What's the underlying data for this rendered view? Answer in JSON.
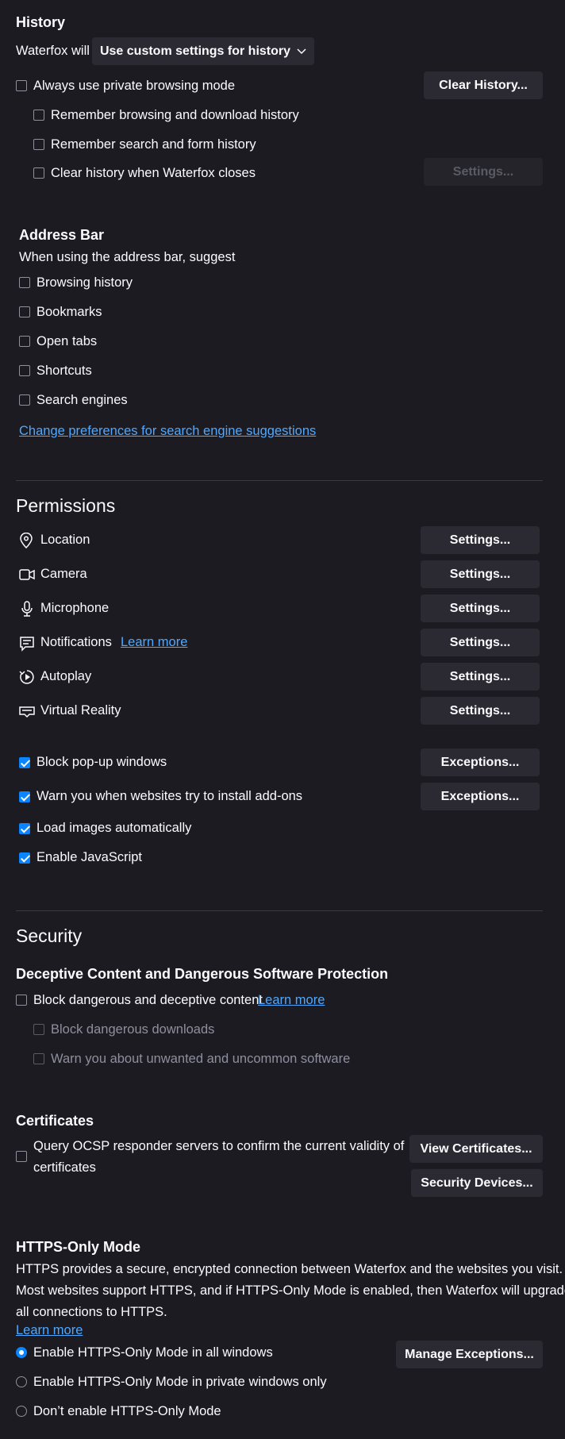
{
  "history": {
    "title": "History",
    "will_label": "Waterfox will",
    "dropdown_value": "Use custom settings for history",
    "always_private": "Always use private browsing mode",
    "clear_history_btn": "Clear History...",
    "remember_browsing": "Remember browsing and download history",
    "remember_search": "Remember search and form history",
    "clear_on_close": "Clear history when Waterfox closes",
    "settings_btn": "Settings..."
  },
  "address_bar": {
    "title": "Address Bar",
    "subtitle": "When using the address bar, suggest",
    "options": [
      "Browsing history",
      "Bookmarks",
      "Open tabs",
      "Shortcuts",
      "Search engines"
    ],
    "link": "Change preferences for search engine suggestions"
  },
  "permissions": {
    "title": "Permissions",
    "items": [
      {
        "label": "Location",
        "icon": "location-icon",
        "button": "Settings..."
      },
      {
        "label": "Camera",
        "icon": "camera-icon",
        "button": "Settings..."
      },
      {
        "label": "Microphone",
        "icon": "microphone-icon",
        "button": "Settings..."
      },
      {
        "label": "Notifications",
        "icon": "notifications-icon",
        "button": "Settings...",
        "learn_more": "Learn more"
      },
      {
        "label": "Autoplay",
        "icon": "autoplay-icon",
        "button": "Settings..."
      },
      {
        "label": "Virtual Reality",
        "icon": "vr-icon",
        "button": "Settings..."
      }
    ],
    "block_popups": "Block pop-up windows",
    "warn_addons": "Warn you when websites try to install add-ons",
    "exceptions_btn": "Exceptions...",
    "load_images": "Load images automatically",
    "enable_js": "Enable JavaScript"
  },
  "security": {
    "title": "Security",
    "deceptive_title": "Deceptive Content and Dangerous Software Protection",
    "block_dangerous": "Block dangerous and deceptive content",
    "learn_more": "Learn more",
    "block_downloads": "Block dangerous downloads",
    "warn_unwanted": "Warn you about unwanted and uncommon software"
  },
  "certificates": {
    "title": "Certificates",
    "ocsp_line1": "Query OCSP responder servers to confirm the current validity of",
    "ocsp_line2": "certificates",
    "view_btn": "View Certificates...",
    "devices_btn": "Security Devices..."
  },
  "https_only": {
    "title": "HTTPS-Only Mode",
    "desc1": "HTTPS provides a secure, encrypted connection between Waterfox and the websites you visit.",
    "desc2": "Most websites support HTTPS, and if HTTPS-Only Mode is enabled, then Waterfox will upgrade",
    "desc3": "all connections to HTTPS.",
    "learn_more": "Learn more",
    "opt_all": "Enable HTTPS-Only Mode in all windows",
    "opt_private": "Enable HTTPS-Only Mode in private windows only",
    "opt_none": "Don’t enable HTTPS-Only Mode",
    "manage_btn": "Manage Exceptions..."
  },
  "colors": {
    "accent": "#0a84ff",
    "link": "#4ea8ff",
    "background": "#1c1b22",
    "button": "#2b2a33"
  }
}
